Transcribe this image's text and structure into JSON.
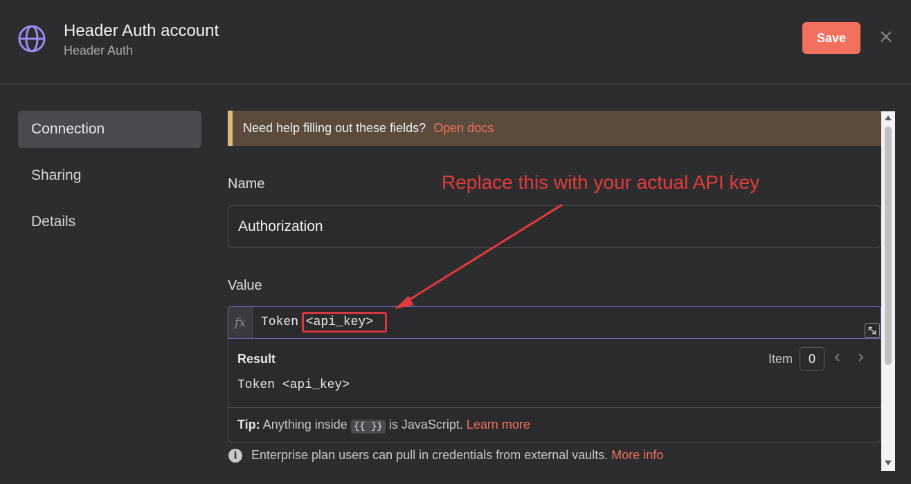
{
  "header": {
    "title": "Header Auth account",
    "subtitle": "Header Auth",
    "save_label": "Save",
    "globe_icon": "globe-icon",
    "close_icon": "close-icon"
  },
  "sidebar": {
    "items": [
      {
        "label": "Connection",
        "active": true
      },
      {
        "label": "Sharing",
        "active": false
      },
      {
        "label": "Details",
        "active": false
      }
    ]
  },
  "banner": {
    "text": "Need help filling out these fields?",
    "link": "Open docs"
  },
  "form": {
    "name_label": "Name",
    "name_value": "Authorization",
    "value_label": "Value",
    "fx_label": "fx",
    "value_prefix": "Token",
    "value_highlight": "<api_key>"
  },
  "result": {
    "label": "Result",
    "item_label": "Item",
    "item_value": "0",
    "value": "Token <api_key>"
  },
  "tip": {
    "bold": "Tip:",
    "text_before": "Anything inside",
    "code": "{{ }}",
    "text_after": "is JavaScript.",
    "link": "Learn more"
  },
  "info": {
    "text": "Enterprise plan users can pull in credentials from external vaults.",
    "link": "More info"
  },
  "annotation": {
    "text": "Replace this with your actual API key"
  },
  "colors": {
    "accent": "#f2705e",
    "annotation": "#e33b3b",
    "focus_border": "#6d68c9"
  }
}
